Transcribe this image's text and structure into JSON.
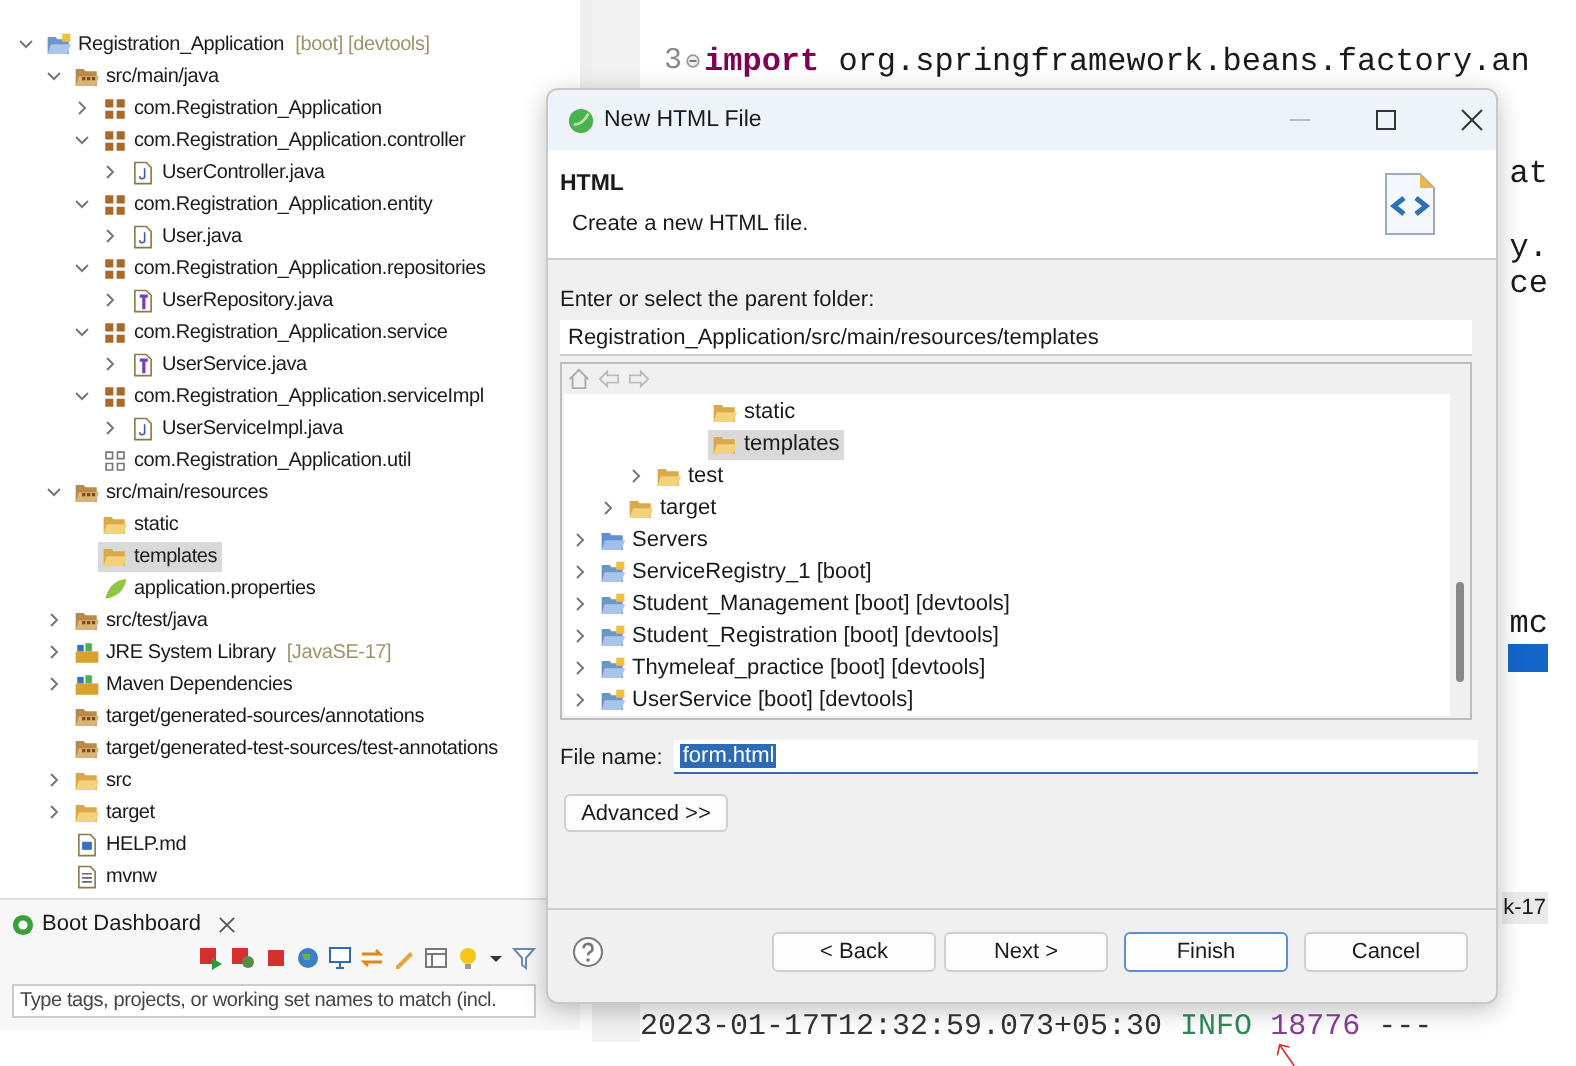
{
  "explorer": {
    "tree": [
      {
        "label": "Registration_Application",
        "suffix": "[boot] [devtools]",
        "kind": "project",
        "expanded": true,
        "selected": false,
        "children": [
          {
            "label": "src/main/java",
            "kind": "source-folder",
            "expanded": true,
            "selected": false,
            "children": [
              {
                "label": "com.Registration_Application",
                "kind": "package",
                "expanded": false,
                "selected": false
              },
              {
                "label": "com.Registration_Application.controller",
                "kind": "package",
                "expanded": true,
                "selected": false,
                "children": [
                  {
                    "label": "UserController.java",
                    "kind": "java-class",
                    "expanded": false,
                    "selected": false
                  }
                ]
              },
              {
                "label": "com.Registration_Application.entity",
                "kind": "package",
                "expanded": true,
                "selected": false,
                "children": [
                  {
                    "label": "User.java",
                    "kind": "java-class",
                    "expanded": false,
                    "selected": false
                  }
                ]
              },
              {
                "label": "com.Registration_Application.repositories",
                "kind": "package",
                "expanded": true,
                "selected": false,
                "children": [
                  {
                    "label": "UserRepository.java",
                    "kind": "java-interface",
                    "expanded": false,
                    "selected": false
                  }
                ]
              },
              {
                "label": "com.Registration_Application.service",
                "kind": "package",
                "expanded": true,
                "selected": false,
                "children": [
                  {
                    "label": "UserService.java",
                    "kind": "java-interface",
                    "expanded": false,
                    "selected": false
                  }
                ]
              },
              {
                "label": "com.Registration_Application.serviceImpl",
                "kind": "package",
                "expanded": true,
                "selected": false,
                "children": [
                  {
                    "label": "UserServiceImpl.java",
                    "kind": "java-class",
                    "expanded": false,
                    "selected": false
                  }
                ]
              },
              {
                "label": "com.Registration_Application.util",
                "kind": "package-empty",
                "selected": false
              }
            ]
          },
          {
            "label": "src/main/resources",
            "kind": "source-folder",
            "expanded": true,
            "selected": false,
            "children": [
              {
                "label": "static",
                "kind": "folder",
                "selected": false
              },
              {
                "label": "templates",
                "kind": "folder",
                "selected": true
              },
              {
                "label": "application.properties",
                "kind": "properties",
                "selected": false
              }
            ]
          },
          {
            "label": "src/test/java",
            "kind": "source-folder",
            "expanded": false,
            "selected": false
          },
          {
            "label": "JRE System Library",
            "suffix": "[JavaSE-17]",
            "kind": "library",
            "expanded": false,
            "selected": false
          },
          {
            "label": "Maven Dependencies",
            "kind": "library",
            "expanded": false,
            "selected": false
          },
          {
            "label": "target/generated-sources/annotations",
            "kind": "source-folder",
            "selected": false
          },
          {
            "label": "target/generated-test-sources/test-annotations",
            "kind": "source-folder",
            "selected": false
          },
          {
            "label": "src",
            "kind": "folder",
            "expanded": false,
            "selected": false
          },
          {
            "label": "target",
            "kind": "folder",
            "expanded": false,
            "selected": false
          },
          {
            "label": "HELP.md",
            "kind": "markdown",
            "selected": false
          },
          {
            "label": "mvnw",
            "kind": "text-file",
            "selected": false
          }
        ]
      }
    ]
  },
  "boot_dashboard": {
    "tab": "Boot Dashboard",
    "filter": {
      "placeholder": "Type tags, projects, or working set names to match (incl."
    }
  },
  "editor": {
    "line_number": "3",
    "keyword": "import",
    "code": " org.springframework.beans.factory.an",
    "fragments": [
      "at",
      "y.",
      "ce",
      "mc"
    ]
  },
  "console": {
    "tab_fragment": "k-17",
    "timestamp": "2023-01-17T12:32:59.073+05:30",
    "level": "INFO",
    "pid": "18776",
    "separator": "---"
  },
  "dialog": {
    "title": "New HTML File",
    "heading": "HTML",
    "description": "Create a new HTML file.",
    "folder_label": "Enter or select the parent folder:",
    "folder_value": "Registration_Application/src/main/resources/templates",
    "tree": [
      {
        "children": [
          {
            "children": [
              {
                "children": [
                  {
                    "children": [
                      {
                        "label": "static",
                        "kind": "folder",
                        "selected": false
                      },
                      {
                        "label": "templates",
                        "kind": "folder",
                        "selected": true
                      }
                    ]
                  }
                ]
              },
              {
                "label": "test",
                "kind": "folder",
                "expanded": false,
                "selected": false
              }
            ]
          },
          {
            "label": "target",
            "kind": "folder",
            "expanded": false,
            "selected": false
          }
        ]
      },
      {
        "label": "Servers",
        "kind": "server-folder",
        "expanded": false,
        "selected": false
      },
      {
        "label": "ServiceRegistry_1 [boot]",
        "kind": "project",
        "expanded": false,
        "selected": false
      },
      {
        "label": "Student_Management [boot] [devtools]",
        "kind": "project",
        "expanded": false,
        "selected": false
      },
      {
        "label": "Student_Registration [boot] [devtools]",
        "kind": "project",
        "expanded": false,
        "selected": false
      },
      {
        "label": "Thymeleaf_practice [boot] [devtools]",
        "kind": "project",
        "expanded": false,
        "selected": false
      },
      {
        "label": "UserService [boot] [devtools]",
        "kind": "project",
        "expanded": false,
        "selected": false
      }
    ],
    "file_name_label": "File name:",
    "file_name_value": "form.html",
    "value_selected": true,
    "advanced_button": "Advanced >>",
    "buttons": [
      {
        "label": "< Back",
        "default": false
      },
      {
        "label": "Next >",
        "default": false
      },
      {
        "label": "Finish",
        "default": true
      },
      {
        "label": "Cancel",
        "default": false
      }
    ]
  }
}
